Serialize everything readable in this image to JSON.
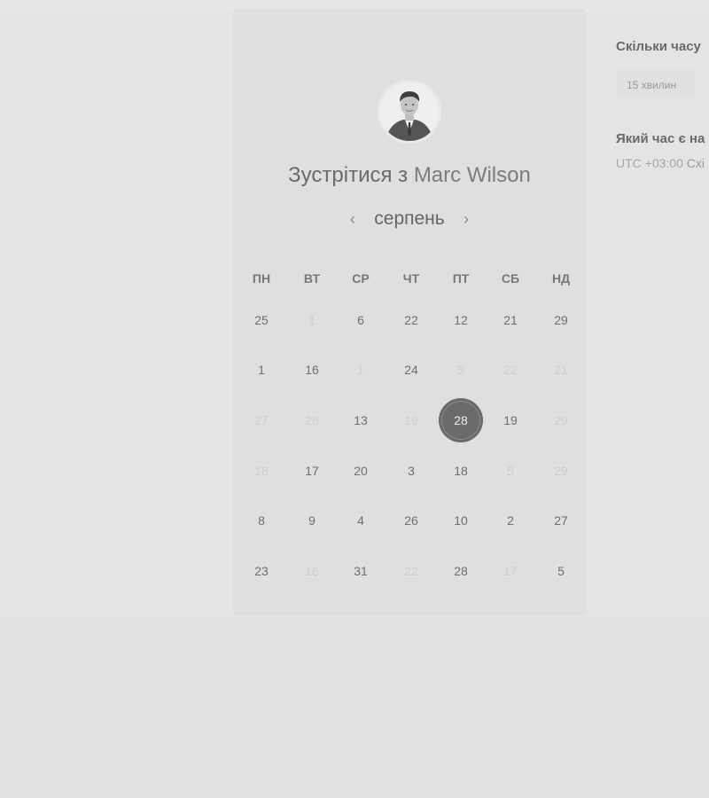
{
  "booking": {
    "title_prefix": "Зустрітися з",
    "host_name": "Marc Wilson",
    "month": "серпень",
    "prev_icon": "‹",
    "next_icon": "›"
  },
  "calendar": {
    "weekdays": [
      "ПН",
      "ВТ",
      "СР",
      "ЧТ",
      "ПТ",
      "СБ",
      "НД"
    ],
    "selected": {
      "row": 2,
      "col": 4
    },
    "rows": [
      [
        {
          "d": "25"
        },
        {
          "d": "1",
          "off": true
        },
        {
          "d": "6"
        },
        {
          "d": "22"
        },
        {
          "d": "12"
        },
        {
          "d": "21"
        },
        {
          "d": "29"
        }
      ],
      [
        {
          "d": "1"
        },
        {
          "d": "16"
        },
        {
          "d": "1",
          "off": true
        },
        {
          "d": "24"
        },
        {
          "d": "3",
          "off": true
        },
        {
          "d": "22",
          "off": true
        },
        {
          "d": "21",
          "off": true
        }
      ],
      [
        {
          "d": "27",
          "off": true
        },
        {
          "d": "28",
          "off": true
        },
        {
          "d": "13"
        },
        {
          "d": "19",
          "off": true
        },
        {
          "d": "28"
        },
        {
          "d": "19"
        },
        {
          "d": "29",
          "off": true
        }
      ],
      [
        {
          "d": "18",
          "off": true
        },
        {
          "d": "17"
        },
        {
          "d": "20"
        },
        {
          "d": "3"
        },
        {
          "d": "18"
        },
        {
          "d": "5",
          "off": true
        },
        {
          "d": "29",
          "off": true
        }
      ],
      [
        {
          "d": "8"
        },
        {
          "d": "9"
        },
        {
          "d": "4"
        },
        {
          "d": "26"
        },
        {
          "d": "10"
        },
        {
          "d": "2"
        },
        {
          "d": "27"
        }
      ],
      [
        {
          "d": "23"
        },
        {
          "d": "16",
          "off": true
        },
        {
          "d": "31"
        },
        {
          "d": "22",
          "off": true
        },
        {
          "d": "28"
        },
        {
          "d": "17",
          "off": true
        },
        {
          "d": "5"
        }
      ]
    ]
  },
  "sidebar": {
    "duration_heading": "Скільки часу",
    "duration_value": "15 хвилин",
    "timezone_heading": "Який час є на",
    "timezone_offset": "UTC +03:00",
    "timezone_name": "Схі"
  },
  "colors": {
    "page_bg": "#e2e2e2",
    "card_bg": "#dfdfdf",
    "selected_day": "#6a6a6a",
    "text": "#6e6e6e",
    "muted_text": "#cfcfcf"
  }
}
